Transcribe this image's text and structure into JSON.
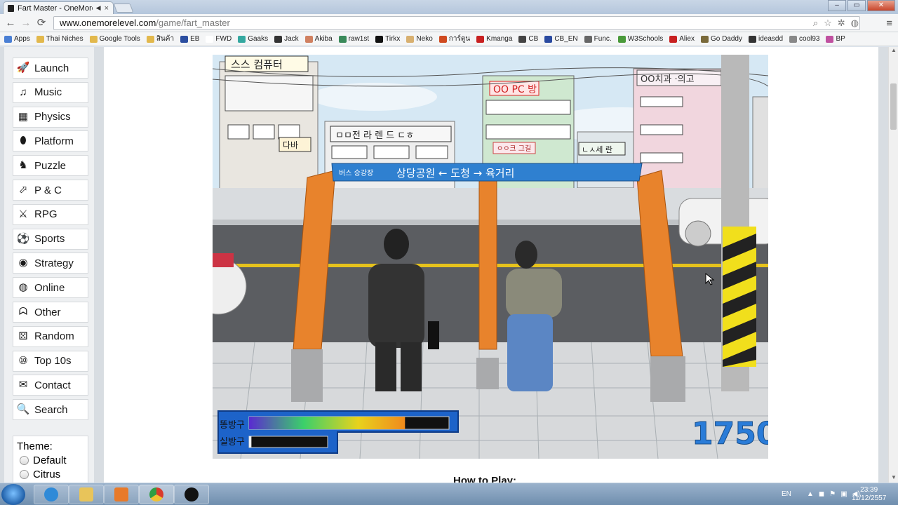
{
  "browser": {
    "tab_title": "Fart Master - OneMore",
    "tab_close": "×",
    "url_domain": "www.onemorelevel.com",
    "url_path": "/game/fart_master",
    "back_icon": "←",
    "forward_icon": "→",
    "reload_icon": "⟳",
    "bookmarks": [
      {
        "label": "Apps",
        "color": "#4a7fd4"
      },
      {
        "label": "Thai Niches",
        "color": "#e2b84c"
      },
      {
        "label": "Google Tools",
        "color": "#e2b84c"
      },
      {
        "label": "สินค้า",
        "color": "#e2b84c"
      },
      {
        "label": "EB",
        "color": "#2b4ea0"
      },
      {
        "label": "FWD",
        "color": "#ffffff"
      },
      {
        "label": "Gaaks",
        "color": "#34a8a0"
      },
      {
        "label": "Jack",
        "color": "#333333"
      },
      {
        "label": "Akiba",
        "color": "#d08060"
      },
      {
        "label": "raw1st",
        "color": "#3a8a5a"
      },
      {
        "label": "Tirkx",
        "color": "#111111"
      },
      {
        "label": "Neko",
        "color": "#d8b070"
      },
      {
        "label": "การ์ตูน",
        "color": "#d04a20"
      },
      {
        "label": "Kmanga",
        "color": "#c82020"
      },
      {
        "label": "CB",
        "color": "#444444"
      },
      {
        "label": "CB_EN",
        "color": "#2a4aa0"
      },
      {
        "label": "Func.",
        "color": "#666666"
      },
      {
        "label": "W3Schools",
        "color": "#4a9a3a"
      },
      {
        "label": "Aliex",
        "color": "#c82020"
      },
      {
        "label": "Go Daddy",
        "color": "#7a6a3a"
      },
      {
        "label": "ideasdd",
        "color": "#333333"
      },
      {
        "label": "cool93",
        "color": "#888888"
      },
      {
        "label": "BP",
        "color": "#c050a0"
      }
    ]
  },
  "sidebar": {
    "items": [
      {
        "label": "Launch",
        "icon": "rocket-icon",
        "glyph": "🚀"
      },
      {
        "label": "Music",
        "icon": "music-note-icon",
        "glyph": "♫"
      },
      {
        "label": "Physics",
        "icon": "blocks-icon",
        "glyph": "▦"
      },
      {
        "label": "Platform",
        "icon": "coin-icon",
        "glyph": "⬮"
      },
      {
        "label": "Puzzle",
        "icon": "chess-knight-icon",
        "glyph": "♞"
      },
      {
        "label": "P & C",
        "icon": "pointer-icon",
        "glyph": "⬀"
      },
      {
        "label": "RPG",
        "icon": "sword-icon",
        "glyph": "⚔"
      },
      {
        "label": "Sports",
        "icon": "soccer-ball-icon",
        "glyph": "⚽"
      },
      {
        "label": "Strategy",
        "icon": "color-ring-icon",
        "glyph": "◉"
      },
      {
        "label": "Online",
        "icon": "globe-icon",
        "glyph": "◍"
      },
      {
        "label": "Other",
        "icon": "ghost-icon",
        "glyph": "ᗣ"
      },
      {
        "label": "Random",
        "icon": "dice-icon",
        "glyph": "⚄"
      },
      {
        "label": "Top 10s",
        "icon": "top10-icon",
        "glyph": "⑩"
      },
      {
        "label": "Contact",
        "icon": "envelope-icon",
        "glyph": "✉"
      },
      {
        "label": "Search",
        "icon": "magnifier-icon",
        "glyph": "🔍"
      }
    ],
    "theme_label": "Theme:",
    "theme_options": [
      "Default",
      "Citrus"
    ]
  },
  "game": {
    "score": "1750",
    "meter1_label": "똥방구",
    "meter2_label": "실방구",
    "meter1_level": 0.78,
    "meter2_level": 0.03,
    "sign_small": "버스 승강장",
    "sign_main": "상당공원 ← 도청 → 육거리",
    "shop_signs": [
      "스스 컴퓨터",
      "OO PC 방",
      "OO치과 ·의고",
      "ㅁㅁ전 라 렌 드 ㄷㅎ",
      "다바",
      "ㅇㅇ크 그길",
      "ㄴㅅ세 란"
    ]
  },
  "content": {
    "how_to_play": "How to Play:"
  },
  "taskbar": {
    "lang": "EN",
    "time": "23:39",
    "date": "11/12/2557"
  }
}
